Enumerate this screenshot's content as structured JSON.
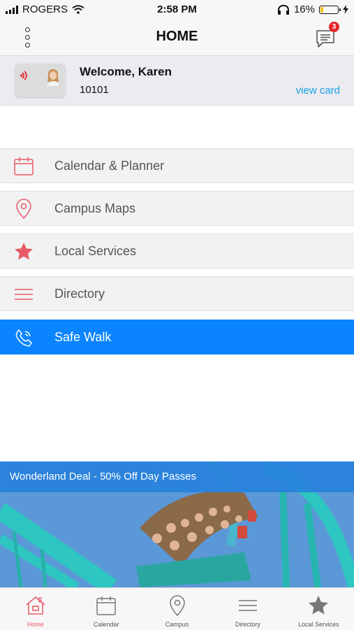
{
  "status_bar": {
    "carrier": "ROGERS",
    "time": "2:58 PM",
    "battery": "16%",
    "battery_level": 0.16
  },
  "header": {
    "title": "HOME",
    "messages_badge": "3"
  },
  "welcome": {
    "greeting": "Welcome, Karen",
    "student_id": "10101",
    "view_card": "view card"
  },
  "menu": [
    {
      "label": "Calendar & Planner",
      "icon": "calendar-icon"
    },
    {
      "label": "Campus Maps",
      "icon": "map-pin-icon"
    },
    {
      "label": "Local Services",
      "icon": "star-icon"
    },
    {
      "label": "Directory",
      "icon": "list-icon"
    },
    {
      "label": "Safe Walk",
      "icon": "phone-icon"
    }
  ],
  "promo": {
    "title": "Wonderland Deal - 50% Off Day Passes"
  },
  "tabs": [
    {
      "label": "Home",
      "icon": "home-icon"
    },
    {
      "label": "Calendar",
      "icon": "calendar-icon"
    },
    {
      "label": "Campus",
      "icon": "map-pin-icon"
    },
    {
      "label": "Directory",
      "icon": "list-icon"
    },
    {
      "label": "Local Services",
      "icon": "star-icon"
    }
  ],
  "colors": {
    "accent": "#e85a65",
    "safe_walk": "#0a84ff",
    "link": "#1aa0e8",
    "badge": "#e5262b"
  }
}
